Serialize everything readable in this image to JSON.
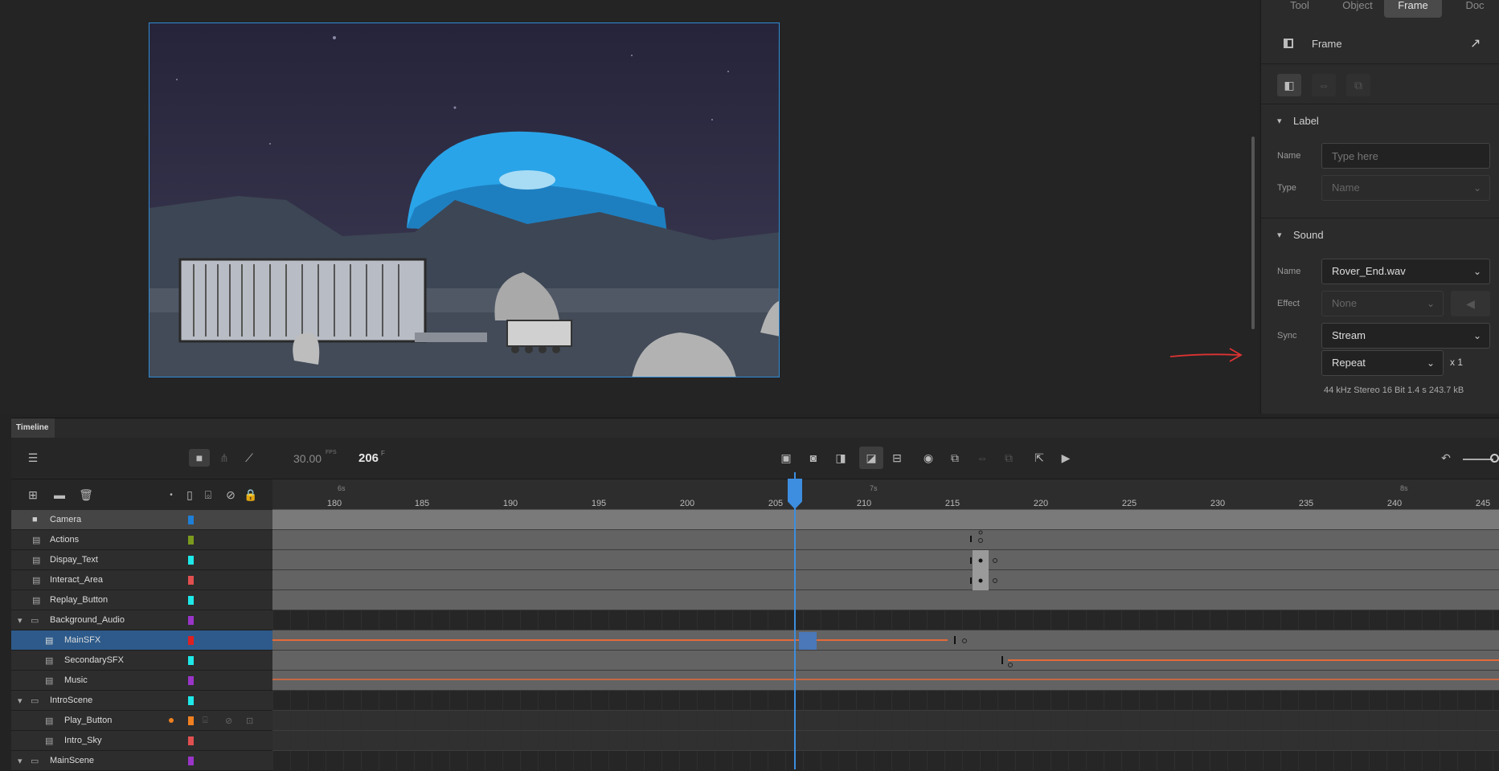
{
  "props": {
    "tabs": [
      "Tool",
      "Object",
      "Frame",
      "Doc"
    ],
    "active_tab": "Frame",
    "header": "Frame",
    "label_section": {
      "title": "Label",
      "name_label": "Name",
      "name_placeholder": "Type here",
      "type_label": "Type",
      "type_value": "Name"
    },
    "sound_section": {
      "title": "Sound",
      "name_label": "Name",
      "name_value": "Rover_End.wav",
      "effect_label": "Effect",
      "effect_value": "None",
      "sync_label": "Sync",
      "sync_value": "Stream",
      "repeat_value": "Repeat",
      "repeat_count": "x 1",
      "info": "44 kHz Stereo 16 Bit 1.4 s 243.7 kB"
    }
  },
  "timeline": {
    "tab": "Timeline",
    "fps": "30.00",
    "fps_unit": "FPS",
    "frame": "206",
    "frame_unit": "F",
    "seconds": [
      "6s",
      "7s",
      "8s"
    ],
    "ticks": [
      "180",
      "185",
      "190",
      "195",
      "200",
      "205",
      "210",
      "215",
      "220",
      "225",
      "230",
      "235",
      "240",
      "245"
    ],
    "layers": [
      {
        "name": "Camera",
        "color": "#1e7fd6",
        "kind": "camera"
      },
      {
        "name": "Actions",
        "color": "#7a9a1e",
        "kind": "layer"
      },
      {
        "name": "Dispay_Text",
        "color": "#1ee8e8",
        "kind": "layer"
      },
      {
        "name": "Interact_Area",
        "color": "#e05050",
        "kind": "layer"
      },
      {
        "name": "Replay_Button",
        "color": "#1ee8e8",
        "kind": "layer"
      },
      {
        "name": "Background_Audio",
        "color": "#9a35c8",
        "kind": "folder"
      },
      {
        "name": "MainSFX",
        "color": "#e02020",
        "kind": "layer",
        "selected": true
      },
      {
        "name": "SecondarySFX",
        "color": "#1ee8e8",
        "kind": "layer"
      },
      {
        "name": "Music",
        "color": "#9a35c8",
        "kind": "layer"
      },
      {
        "name": "IntroScene",
        "color": "#1ee8e8",
        "kind": "folder"
      },
      {
        "name": "Play_Button",
        "color": "#f08020",
        "kind": "layer"
      },
      {
        "name": "Intro_Sky",
        "color": "#e05050",
        "kind": "layer"
      },
      {
        "name": "MainScene",
        "color": "#9a35c8",
        "kind": "folder"
      }
    ]
  }
}
